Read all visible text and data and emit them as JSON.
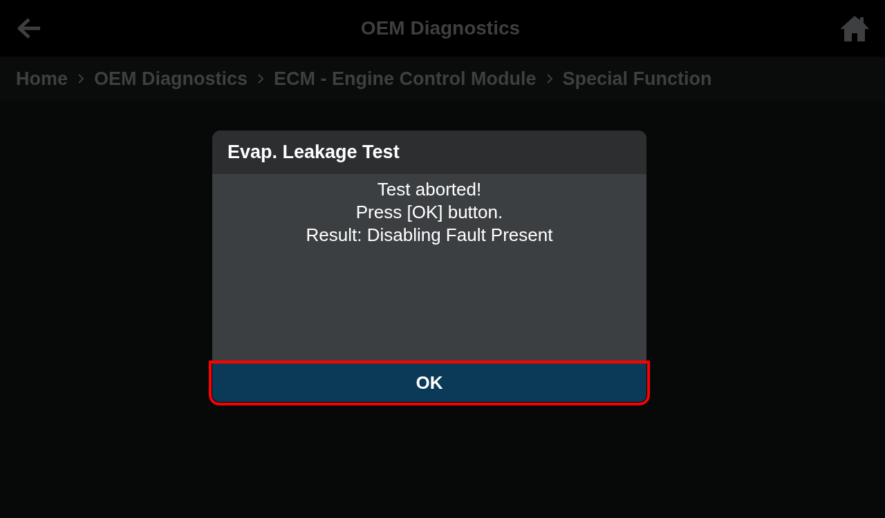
{
  "header": {
    "title": "OEM Diagnostics"
  },
  "breadcrumb": [
    "Home",
    "OEM Diagnostics",
    "ECM - Engine Control Module",
    "Special Function"
  ],
  "dialog": {
    "title": "Evap. Leakage Test",
    "message": [
      "Test aborted!",
      "Press [OK] button.",
      "Result: Disabling Fault Present"
    ],
    "buttons": [
      {
        "label": "OK",
        "highlighted": true
      }
    ]
  }
}
